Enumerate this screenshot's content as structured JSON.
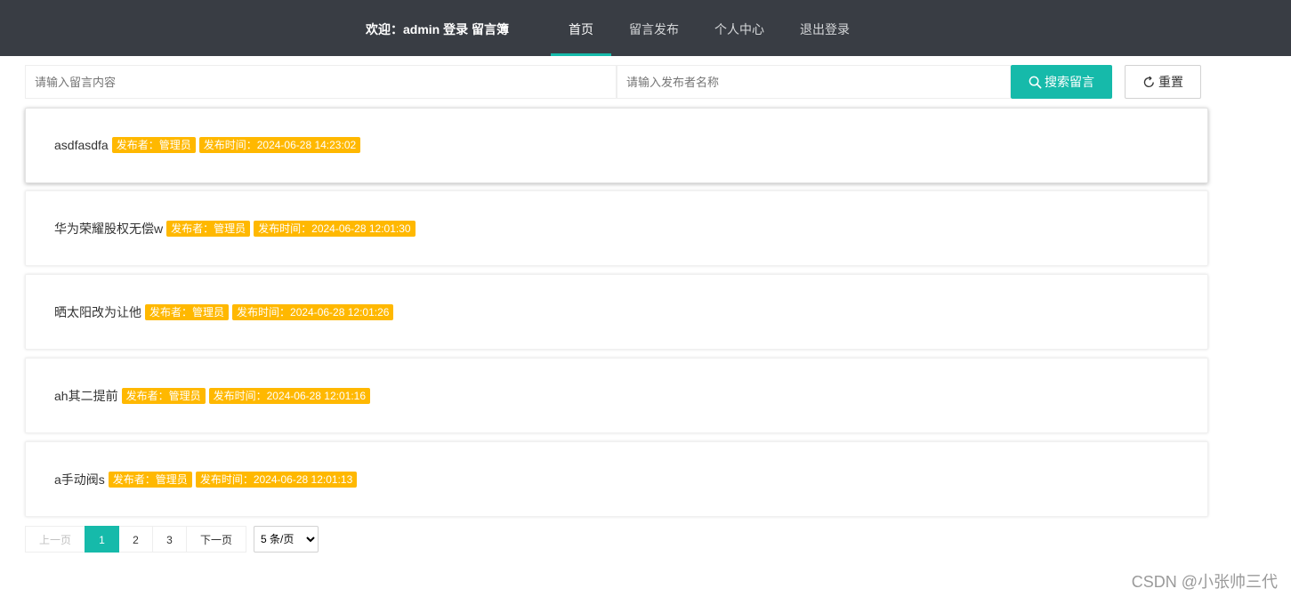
{
  "header": {
    "brand": "欢迎：admin 登录 留言簿",
    "nav": [
      {
        "label": "首页",
        "active": true
      },
      {
        "label": "留言发布",
        "active": false
      },
      {
        "label": "个人中心",
        "active": false
      },
      {
        "label": "退出登录",
        "active": false
      }
    ]
  },
  "search": {
    "content_placeholder": "请输入留言内容",
    "author_placeholder": "请输入发布者名称",
    "search_label": "搜索留言",
    "reset_label": "重置"
  },
  "messages": [
    {
      "content": "asdfasdfa",
      "author": "发布者：管理员",
      "time": "发布时间：2024-06-28 14:23:02"
    },
    {
      "content": "华为荣耀股权无偿w",
      "author": "发布者：管理员",
      "time": "发布时间：2024-06-28 12:01:30"
    },
    {
      "content": "晒太阳改为让他",
      "author": "发布者：管理员",
      "time": "发布时间：2024-06-28 12:01:26"
    },
    {
      "content": "ah其二提前",
      "author": "发布者：管理员",
      "time": "发布时间：2024-06-28 12:01:16"
    },
    {
      "content": "a手动阀s",
      "author": "发布者：管理员",
      "time": "发布时间：2024-06-28 12:01:13"
    }
  ],
  "pagination": {
    "prev": "上一页",
    "pages": [
      "1",
      "2",
      "3"
    ],
    "current": "1",
    "next": "下一页",
    "page_size": "5 条/页"
  },
  "watermark": "CSDN @小张帅三代",
  "colors": {
    "navbar": "#393d44",
    "accent": "#16baaa",
    "badge": "#ffb800"
  },
  "icons": {
    "search_button_icon": "search-icon",
    "reset_button_icon": "refresh-icon",
    "page_size_icon": "chevron-down-icon"
  }
}
